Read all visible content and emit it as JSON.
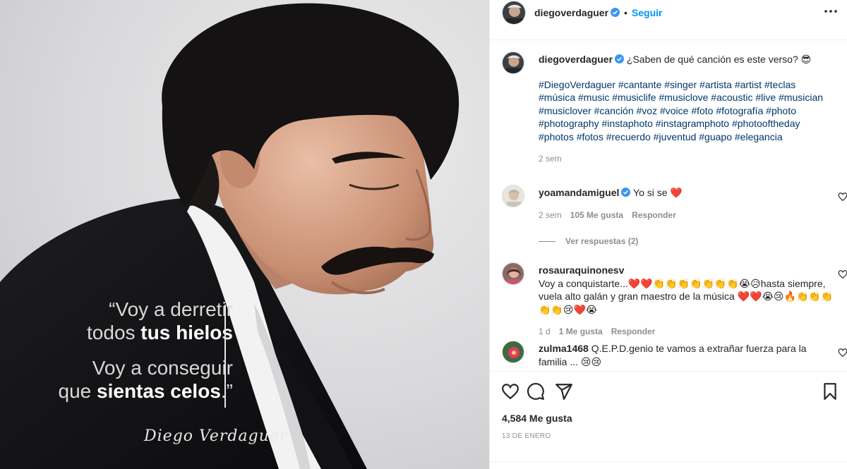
{
  "header": {
    "username": "diegoverdaguer",
    "separator": "•",
    "follow_label": "Seguir",
    "more_icon": "more-options-icon"
  },
  "image": {
    "quote_line1": "“Voy a derretir",
    "quote_line2a": "todos ",
    "quote_line2b": "tus hielos",
    "quote_line3": "Voy a conseguir",
    "quote_line4a": "que ",
    "quote_line4b": "sientas celos",
    "quote_line4c": ".”",
    "signature": "Diego Verdaguer"
  },
  "caption": {
    "username": "diegoverdaguer",
    "text": "¿Saben de qué canción es este verso? 😎",
    "hashtags": "#DiegoVerdaguer #cantante #singer #artista #artist #teclas #música #music #musiclife #musiclove #acoustic #live #musician #musiclover #canción #voz #voice #foto #fotografía #photo #photography #instaphoto #instagramphoto #photooftheday #photos #fotos #recuerdo #juventud #guapo #elegancia",
    "time": "2 sem"
  },
  "comments": [
    {
      "username": "yoamandamiguel",
      "verified": true,
      "text": "Yo si se ❤️",
      "time": "2 sem",
      "likes": "105 Me gusta",
      "reply": "Responder",
      "view_replies": "Ver respuestas (2)"
    },
    {
      "username": "rosauraquinonesv",
      "verified": false,
      "text": "Voy a conquistarte...❤️❤️👏👏👏👏👏👏👏😭😥hasta siempre, vuela alto galán y gran maestro de la música ❤️❤️😭😢🔥👏👏👏👏👏😢❤️😭",
      "time": "1 d",
      "likes": "1 Me gusta",
      "reply": "Responder"
    },
    {
      "username": "zulma1468",
      "verified": false,
      "text": "Q.E.P.D.genio te vamos a extrañar fuerza para la familia ... 😢😢"
    }
  ],
  "actions": {
    "like_icon": "heart-icon",
    "comment_icon": "comment-icon",
    "share_icon": "share-icon",
    "save_icon": "bookmark-icon",
    "likes": "4,584 Me gusta",
    "date": "13 DE ENERO"
  },
  "colors": {
    "link": "#0095f6",
    "hashtag": "#00376b",
    "muted": "#8e8e8e",
    "verified": "#3897f0",
    "heart": "#ed4956"
  }
}
